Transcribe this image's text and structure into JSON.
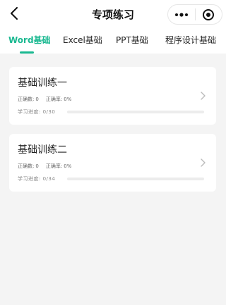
{
  "header": {
    "title": "专项练习",
    "back_icon": "chevron-left-icon",
    "more_icon": "more-dots-icon",
    "close_icon": "target-close-icon"
  },
  "tabs": [
    {
      "label": "Word基础",
      "active": true
    },
    {
      "label": "Excel基础",
      "active": false
    },
    {
      "label": "PPT基础",
      "active": false
    },
    {
      "label": "程序设计基础",
      "active": false
    }
  ],
  "accent_color": "#19b890",
  "cards": [
    {
      "title": "基础训练一",
      "correct_label": "正确数:",
      "correct_value": "0",
      "rate_label": "正确率:",
      "rate_value": "0%",
      "progress_label": "学习进度:",
      "progress_text": "0/30",
      "progress_fraction": 0
    },
    {
      "title": "基础训练二",
      "correct_label": "正确数:",
      "correct_value": "0",
      "rate_label": "正确率:",
      "rate_value": "0%",
      "progress_label": "学习进度:",
      "progress_text": "0/34",
      "progress_fraction": 0
    }
  ]
}
